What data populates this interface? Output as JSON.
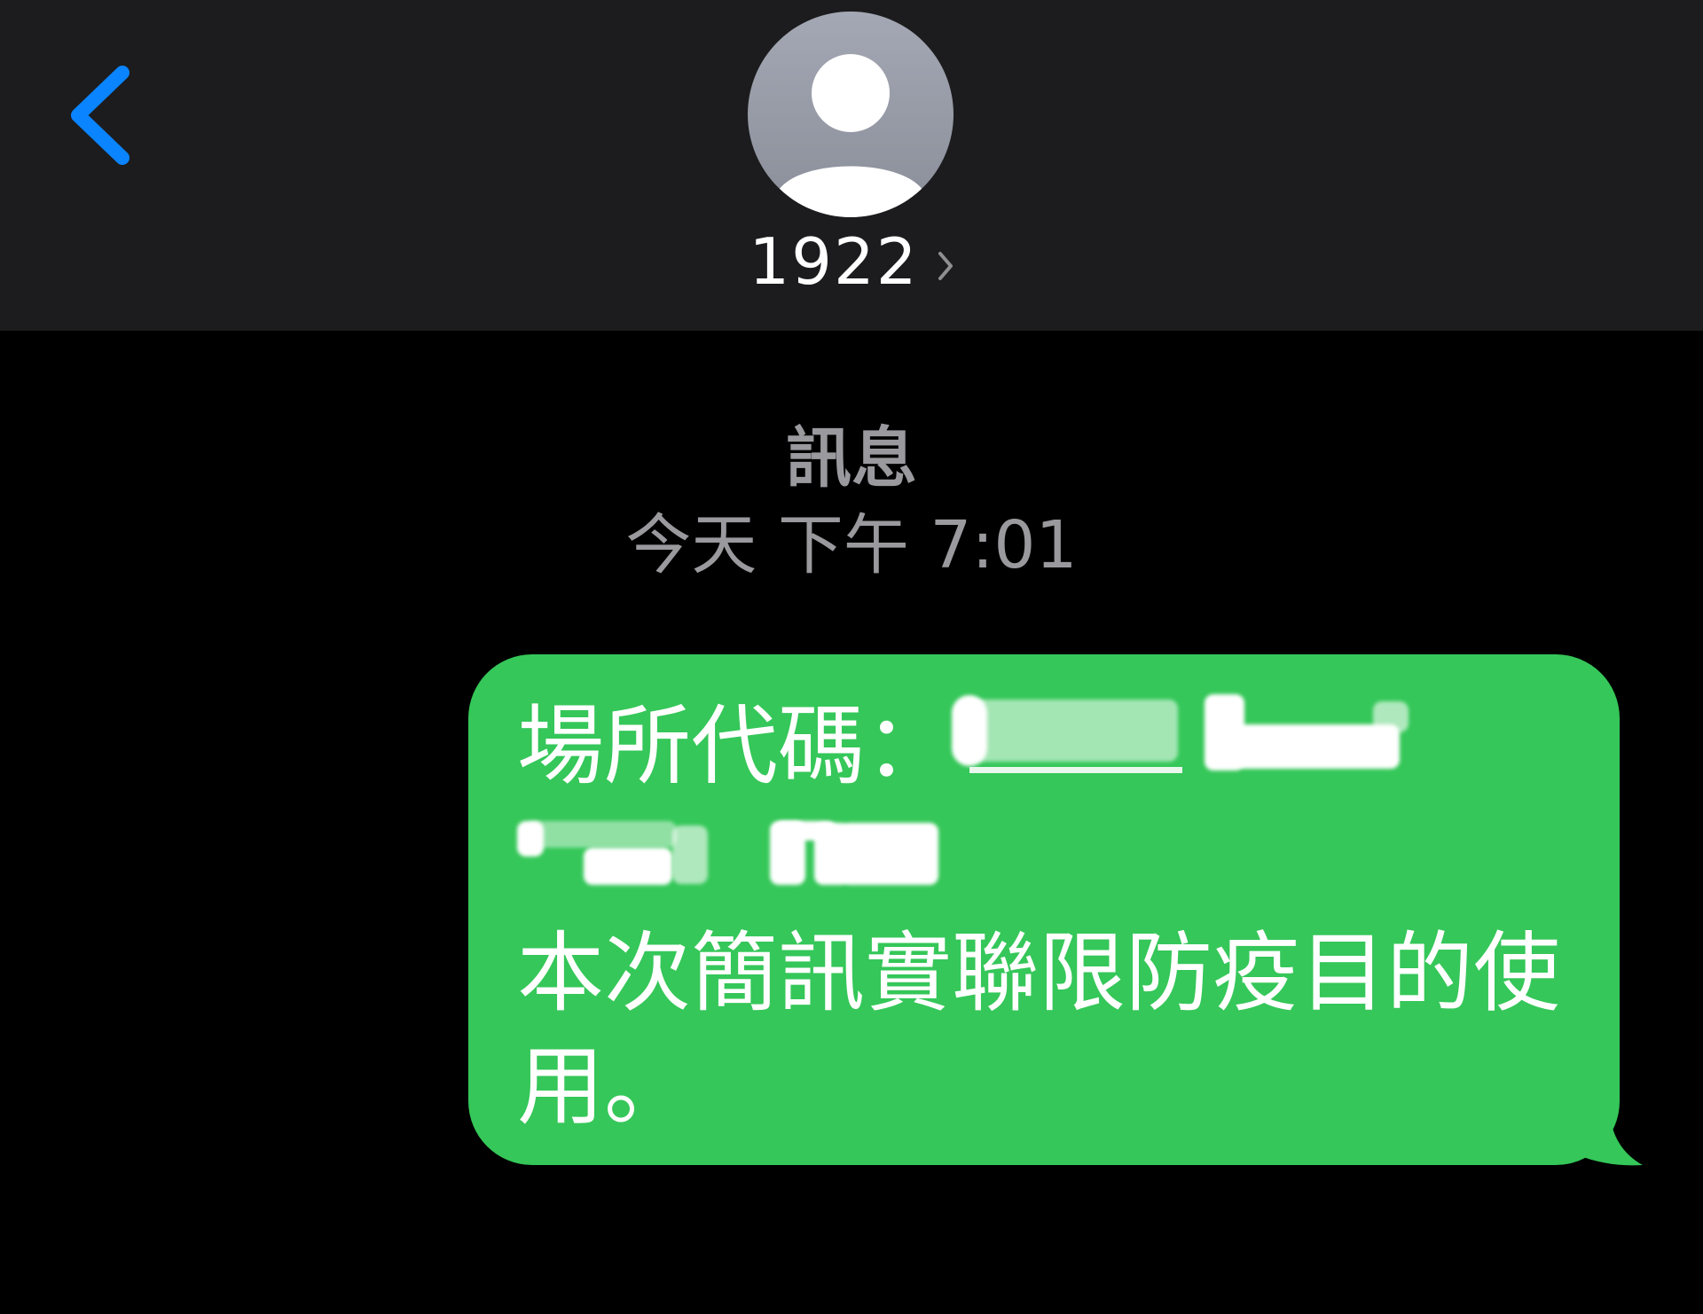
{
  "header": {
    "back_icon": "chevron-left-icon",
    "avatar_icon": "person-silhouette-icon",
    "contact_name": "1922",
    "contact_chevron_icon": "chevron-right-icon",
    "colors": {
      "bar_background": "#1c1c1e",
      "accent": "#0a84ff",
      "avatar": "#9a9ea9"
    }
  },
  "conversation": {
    "service_label": "訊息",
    "timestamp": "今天 下午 7:01",
    "messages": [
      {
        "direction": "outgoing",
        "bubble_color": "#35c759",
        "prefix": "場所代碼：",
        "code_redacted": true,
        "body": "本次簡訊實聯限防疫目的使用。"
      }
    ]
  }
}
